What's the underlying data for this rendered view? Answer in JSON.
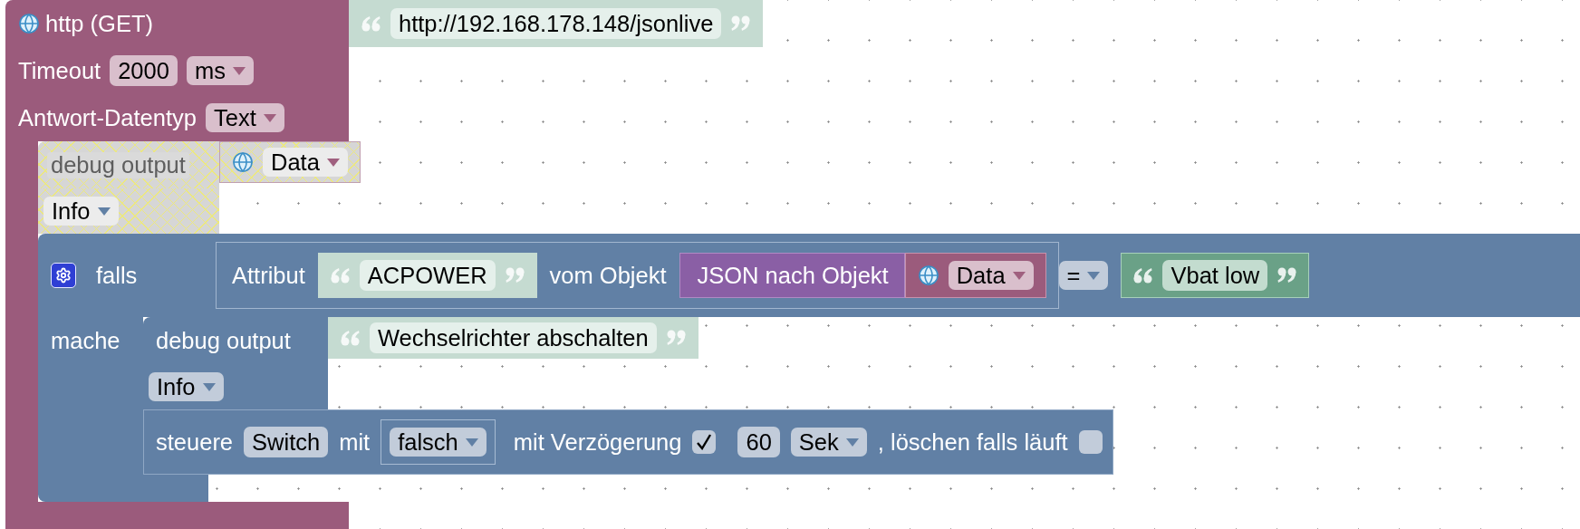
{
  "http_block": {
    "label": "http (GET)",
    "url": {
      "text": "http://192.168.178.148/jsonlive",
      "shadow": true
    },
    "timeout_label": "Timeout",
    "timeout": "2000",
    "timeout_unit": "ms",
    "response_type_label": "Antwort-Datentyp",
    "response_type": "Text",
    "statements": [
      {
        "kind": "debug",
        "disabled": true,
        "label": "debug output",
        "value": {
          "kind": "variable",
          "name": "Data"
        },
        "log_level": "Info"
      },
      {
        "kind": "if",
        "label": "falls",
        "do_label": "mache",
        "condition": {
          "attribute_label": "Attribut",
          "attribute": {
            "text": "ACPOWER",
            "shadow": true
          },
          "object_label": "vom Objekt",
          "converter_label": "JSON nach Objekt",
          "variable": "Data",
          "operator": "=",
          "compare_to": {
            "text": "Vbat low",
            "shadow": false
          }
        },
        "statements": [
          {
            "kind": "debug",
            "disabled": false,
            "label": "debug output",
            "value": {
              "kind": "text",
              "text": "Wechselrichter abschalten",
              "shadow": true
            },
            "log_level": "Info"
          },
          {
            "kind": "control",
            "label": "steuere",
            "object": "Switch",
            "with_label": "mit",
            "value": "falsch",
            "delay_label": "mit Verzögerung",
            "delay_checked": true,
            "delay": "60",
            "unit": "Sek",
            "clear_label": ", löschen falls läuft",
            "clear_checked": false
          }
        ]
      }
    ]
  }
}
